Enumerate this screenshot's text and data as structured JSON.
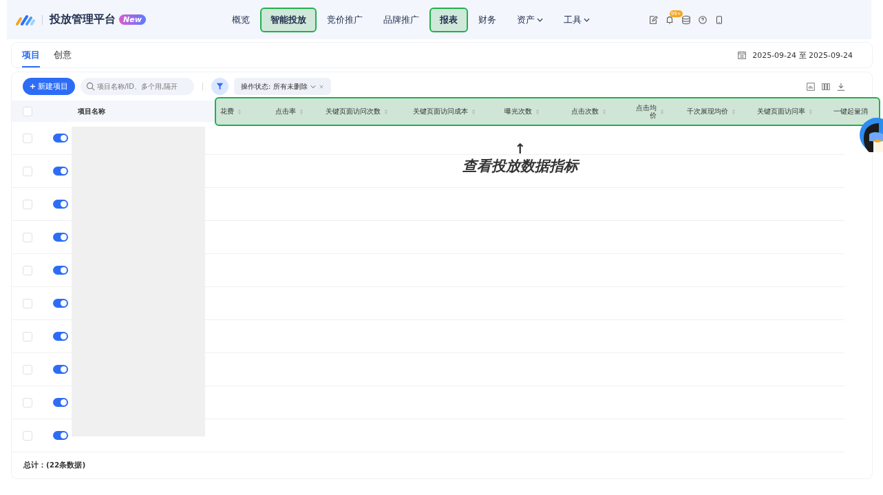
{
  "header": {
    "title": "投放管理平台",
    "badge": "New",
    "nav": [
      {
        "label": "概览",
        "highlighted": false,
        "dropdown": false
      },
      {
        "label": "智能投放",
        "highlighted": true,
        "dropdown": false
      },
      {
        "label": "竞价推广",
        "highlighted": false,
        "dropdown": false
      },
      {
        "label": "品牌推广",
        "highlighted": false,
        "dropdown": false
      },
      {
        "label": "报表",
        "highlighted": true,
        "dropdown": false
      },
      {
        "label": "财务",
        "highlighted": false,
        "dropdown": false
      },
      {
        "label": "资产",
        "highlighted": false,
        "dropdown": true
      },
      {
        "label": "工具",
        "highlighted": false,
        "dropdown": true
      }
    ],
    "notification_count": "99+"
  },
  "tabs": [
    {
      "label": "项目",
      "selected": true
    },
    {
      "label": "创意",
      "selected": false
    }
  ],
  "date_range": "2025-09-24 至 2025-09-24",
  "toolbar": {
    "new_button": "新建项目",
    "search": {
      "placeholder": "项目名称/ID、多个用,隔开"
    },
    "filter_tag": "操作状态: 所有未删除"
  },
  "table": {
    "select_all_checked": false,
    "name_column": "项目名称",
    "metric_columns_highlighted": true,
    "metric_columns": [
      "花费",
      "点击率",
      "关键页面访问次数",
      "关键页面访问成本",
      "曝光次数",
      "点击次数",
      "点击均价",
      "千次展现均价",
      "关键页面访问率",
      "一键起量消"
    ],
    "rows": [
      {
        "checked": false,
        "on": true
      },
      {
        "checked": false,
        "on": true
      },
      {
        "checked": false,
        "on": true
      },
      {
        "checked": false,
        "on": true
      },
      {
        "checked": false,
        "on": true
      },
      {
        "checked": false,
        "on": true
      },
      {
        "checked": false,
        "on": true
      },
      {
        "checked": false,
        "on": true
      },
      {
        "checked": false,
        "on": true
      },
      {
        "checked": false,
        "on": true
      }
    ],
    "total": "总计：(22条数据)"
  },
  "annotation": {
    "arrow": "↑",
    "text": "查看投放数据指标"
  }
}
